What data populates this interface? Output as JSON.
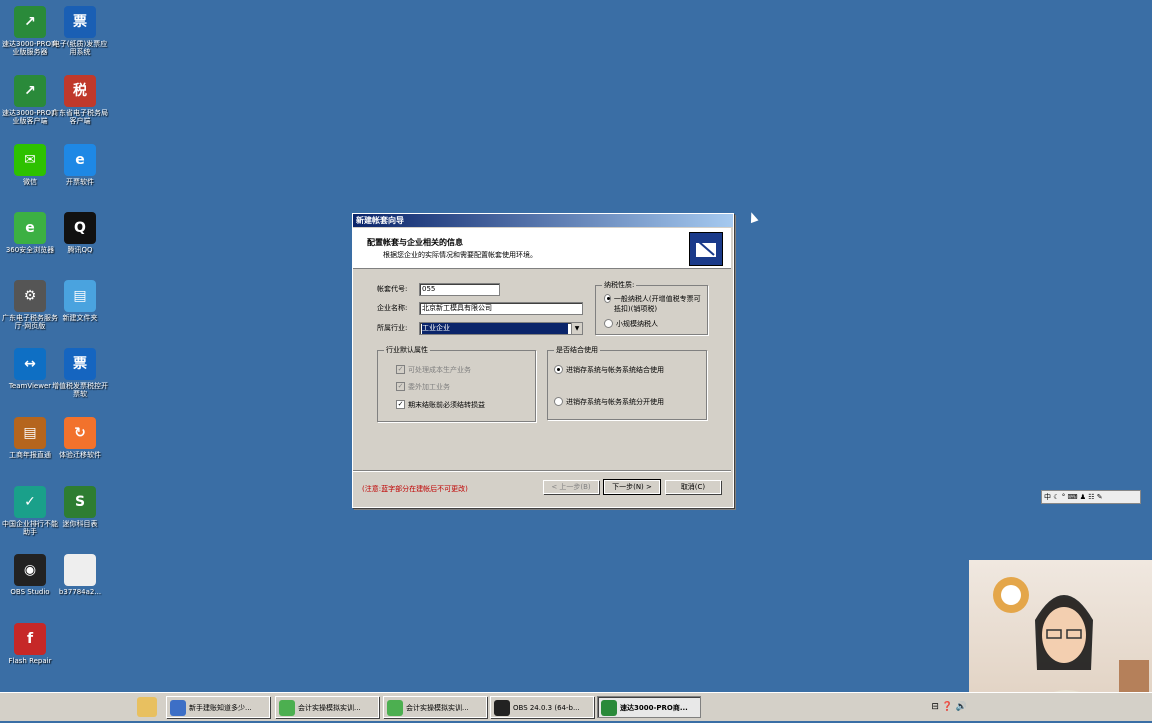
{
  "desktop_icons": [
    {
      "label": "速达3000-PRO商业版服务器",
      "color": "#2a8a3a",
      "glyph": "↗"
    },
    {
      "label": "电子(纸质)发票应用系统",
      "color": "#1a5fb4",
      "glyph": "票"
    },
    {
      "label": "速达3000-PRO商业版客户端",
      "color": "#2a8a3a",
      "glyph": "↗"
    },
    {
      "label": "广东省电子税务局客户端",
      "color": "#c0392b",
      "glyph": "税"
    },
    {
      "label": "微信",
      "color": "#2dc100",
      "glyph": "✉"
    },
    {
      "label": "开票软件",
      "color": "#1e88e5",
      "glyph": "e"
    },
    {
      "label": "360安全浏览器",
      "color": "#3cb043",
      "glyph": "e"
    },
    {
      "label": "腾讯QQ",
      "color": "#111111",
      "glyph": "Q"
    },
    {
      "label": "广东电子税务服务厅-网页版",
      "color": "#555555",
      "glyph": "⚙"
    },
    {
      "label": "新建文件夹",
      "color": "#4aa3df",
      "glyph": "▤"
    },
    {
      "label": "TeamViewer",
      "color": "#0e6fc4",
      "glyph": "↔"
    },
    {
      "label": "增值税发票税控开票软",
      "color": "#1565c0",
      "glyph": "票"
    },
    {
      "label": "工商年报直通",
      "color": "#b5651d",
      "glyph": "▤"
    },
    {
      "label": "体验迁移软件",
      "color": "#f2722c",
      "glyph": "↻"
    },
    {
      "label": "中国企业排行不能助手",
      "color": "#1aa08a",
      "glyph": "✓"
    },
    {
      "label": "迷你科目表",
      "color": "#2e7d32",
      "glyph": "S"
    },
    {
      "label": "OBS Studio",
      "color": "#222222",
      "glyph": "◉"
    },
    {
      "label": "b37784a2...",
      "color": "#eeeeee",
      "glyph": ""
    },
    {
      "label": "Flash Repair",
      "color": "#c62828",
      "glyph": "f"
    }
  ],
  "dialog": {
    "title": "新建帐套向导",
    "header_title": "配置帐套与企业相关的信息",
    "header_subtitle": "根据您企业的实际情况和需要配置帐套使用环境。",
    "account_code_label": "帐套代号:",
    "account_code_value": "055",
    "company_name_label": "企业名称:",
    "company_name_value": "北京新工模具有限公司",
    "industry_label": "所属行业:",
    "industry_value": "工业企业",
    "tax_group_title": "纳税性质:",
    "tax_option1": "一般纳税人(开增值税专票可抵扣)(销项税)",
    "tax_option2": "小规模纳税人",
    "attr_group_title": "行业默认属性",
    "attr1": "可处理成本生产业务",
    "attr2": "委外加工业务",
    "attr3": "期末结账前必须结转损益",
    "combo_group_title": "是否结合使用",
    "combo_option1": "进销存系统与帐务系统结合使用",
    "combo_option2": "进销存系统与帐务系统分开使用",
    "note": "(注意:蓝字部分在建帐后不可更改)",
    "prev_button": "< 上一步(B)",
    "next_button": "下一步(N) >",
    "cancel_button": "取消(C)"
  },
  "taskbar": {
    "items": [
      {
        "label": "新手建账知道多少...",
        "color": "#3d6fc6"
      },
      {
        "label": "会计实操模拟实训...",
        "color": "#4caf50"
      },
      {
        "label": "会计实操模拟实训...",
        "color": "#4caf50"
      },
      {
        "label": "OBS 24.0.3 (64-b...",
        "color": "#222222"
      },
      {
        "label": "速达3000-PRO商...",
        "color": "#2a8a3a"
      }
    ],
    "tray_icons": "⊟ ❓ 🔊"
  },
  "ime_bar": "中 ☾ ° ⌨ ♟ ☷ ✎"
}
